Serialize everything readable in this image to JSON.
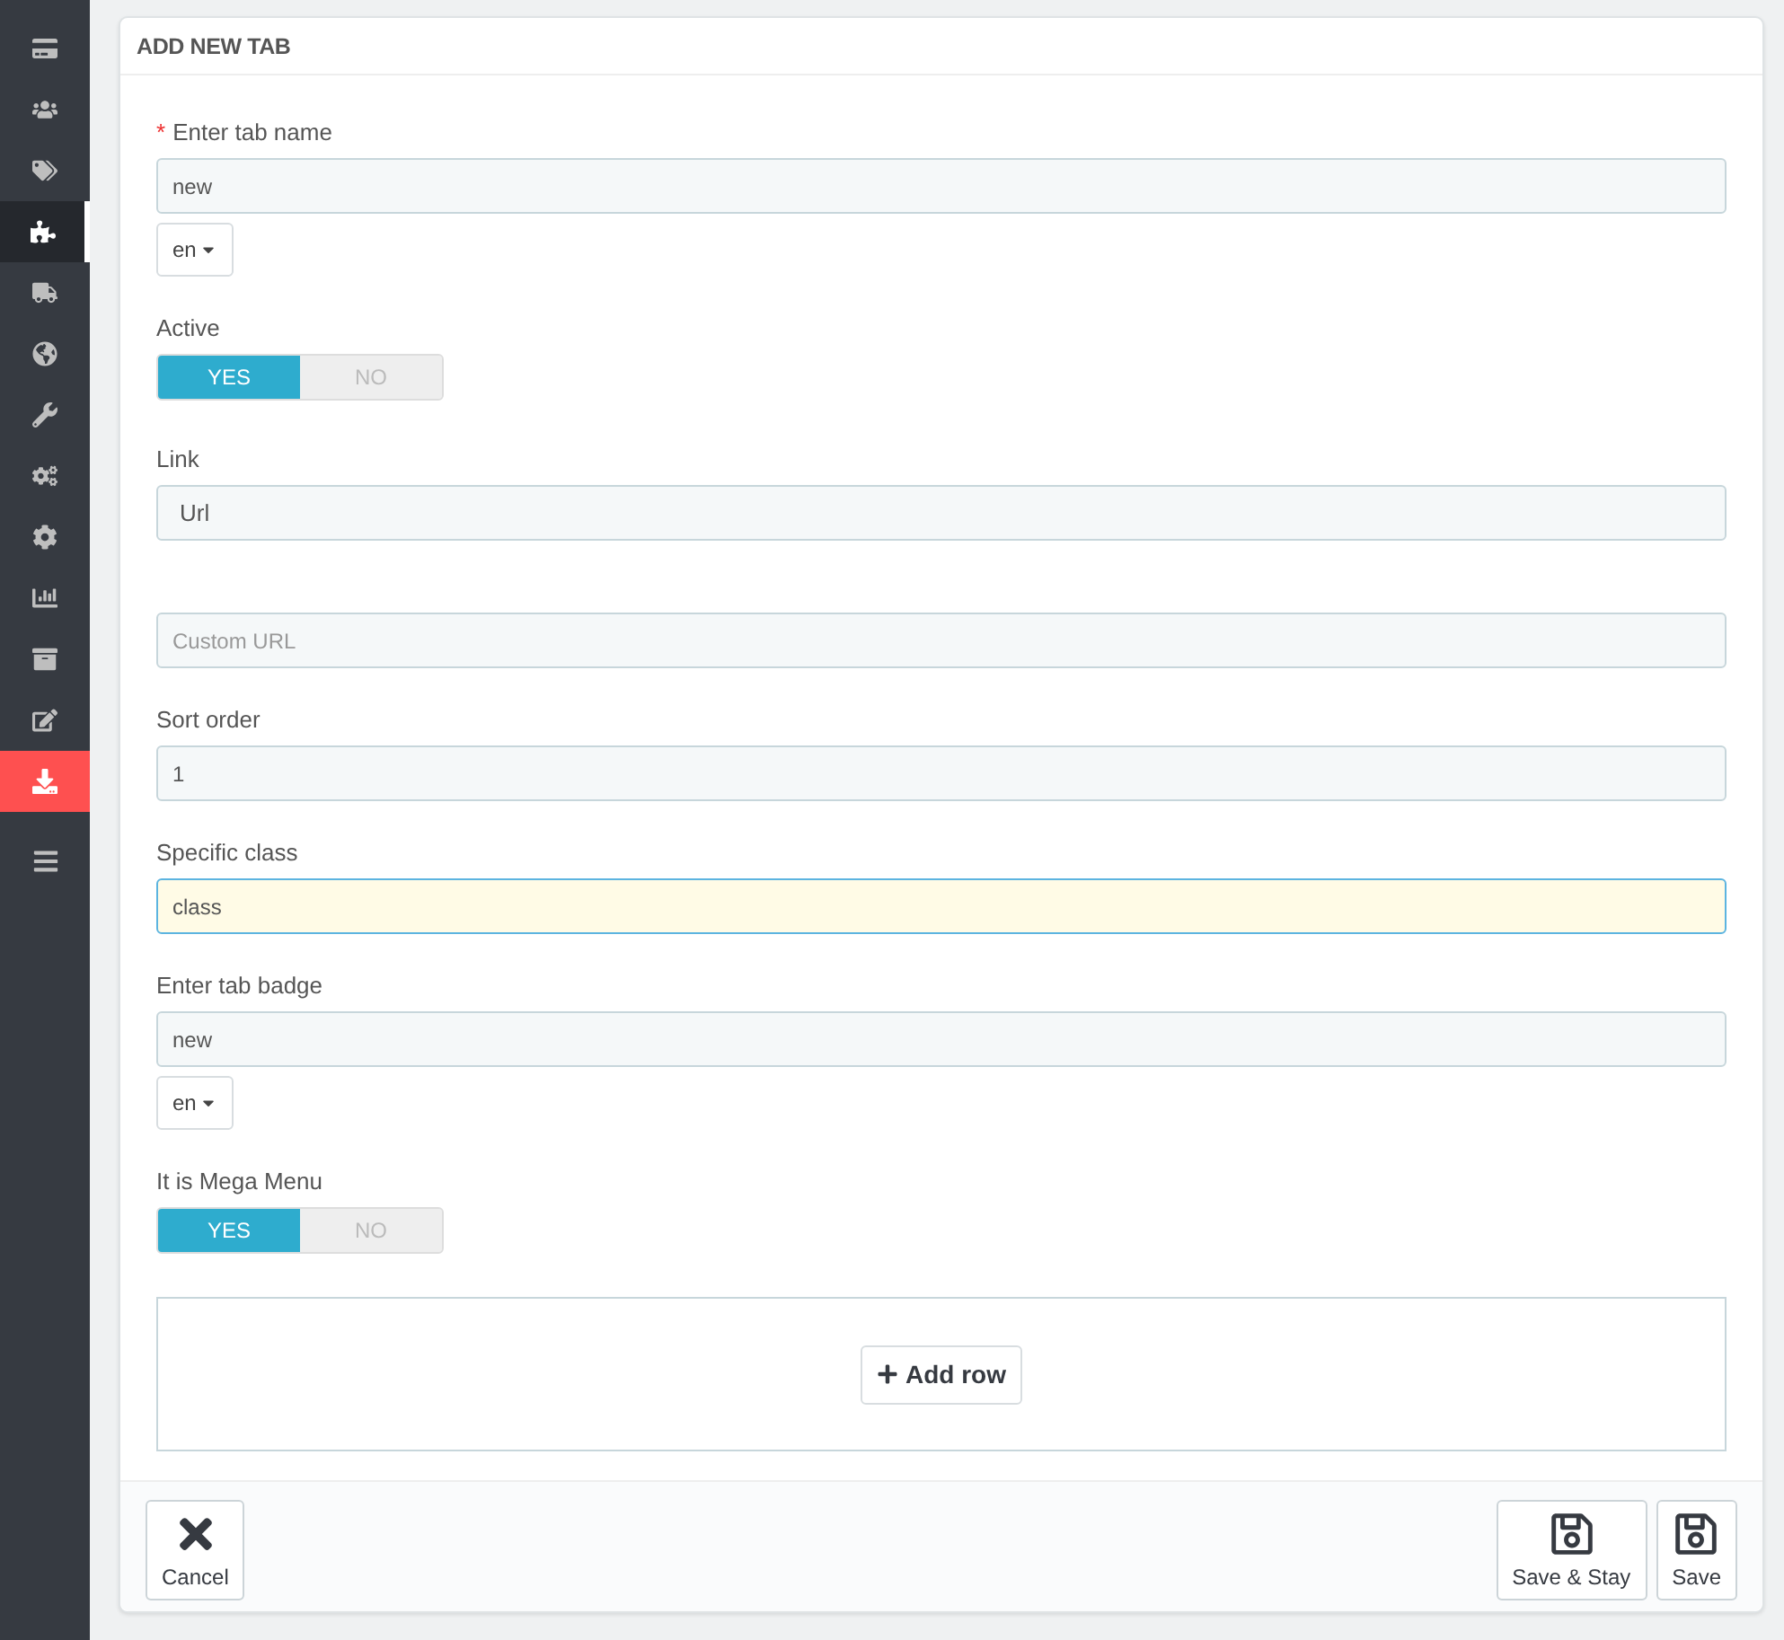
{
  "sidebar": {
    "items": [
      {
        "selected": false,
        "accent": false
      },
      {
        "selected": false,
        "accent": false
      },
      {
        "selected": false,
        "accent": false
      },
      {
        "selected": true,
        "accent": false
      },
      {
        "selected": false,
        "accent": false
      },
      {
        "selected": false,
        "accent": false
      },
      {
        "selected": false,
        "accent": false
      },
      {
        "selected": false,
        "accent": false
      },
      {
        "selected": false,
        "accent": false
      },
      {
        "selected": false,
        "accent": false
      },
      {
        "selected": false,
        "accent": false
      },
      {
        "selected": false,
        "accent": false
      },
      {
        "selected": false,
        "accent": true
      }
    ]
  },
  "panel": {
    "title": "ADD NEW TAB",
    "fields": [
      {
        "kind": "text",
        "label": "Enter tab name",
        "required_mark": "*",
        "value": "new",
        "language": "en",
        "focused": false
      },
      {
        "kind": "switch",
        "label": "Active",
        "options": [
          {
            "label": "YES",
            "selected": true
          },
          {
            "label": "NO",
            "selected": false
          }
        ]
      },
      {
        "kind": "select",
        "label": "Link",
        "value": "Url"
      },
      {
        "kind": "text",
        "placeholder": "Custom URL",
        "focused": false
      },
      {
        "kind": "text",
        "label": "Sort order",
        "value": "1",
        "focused": false
      },
      {
        "kind": "text",
        "label": "Specific class",
        "value": "class",
        "focused": true
      },
      {
        "kind": "text",
        "label": "Enter tab badge",
        "value": "new",
        "language": "en",
        "focused": false
      },
      {
        "kind": "switch",
        "label": "It is Mega Menu",
        "options": [
          {
            "label": "YES",
            "selected": true
          },
          {
            "label": "NO",
            "selected": false
          }
        ]
      },
      {
        "kind": "rows",
        "button": "Add row"
      }
    ],
    "footer": {
      "left": [
        {
          "kind": "cancel",
          "label": "Cancel"
        }
      ],
      "right": [
        {
          "kind": "save",
          "label": "Save & Stay"
        },
        {
          "kind": "save",
          "label": "Save"
        }
      ]
    }
  }
}
